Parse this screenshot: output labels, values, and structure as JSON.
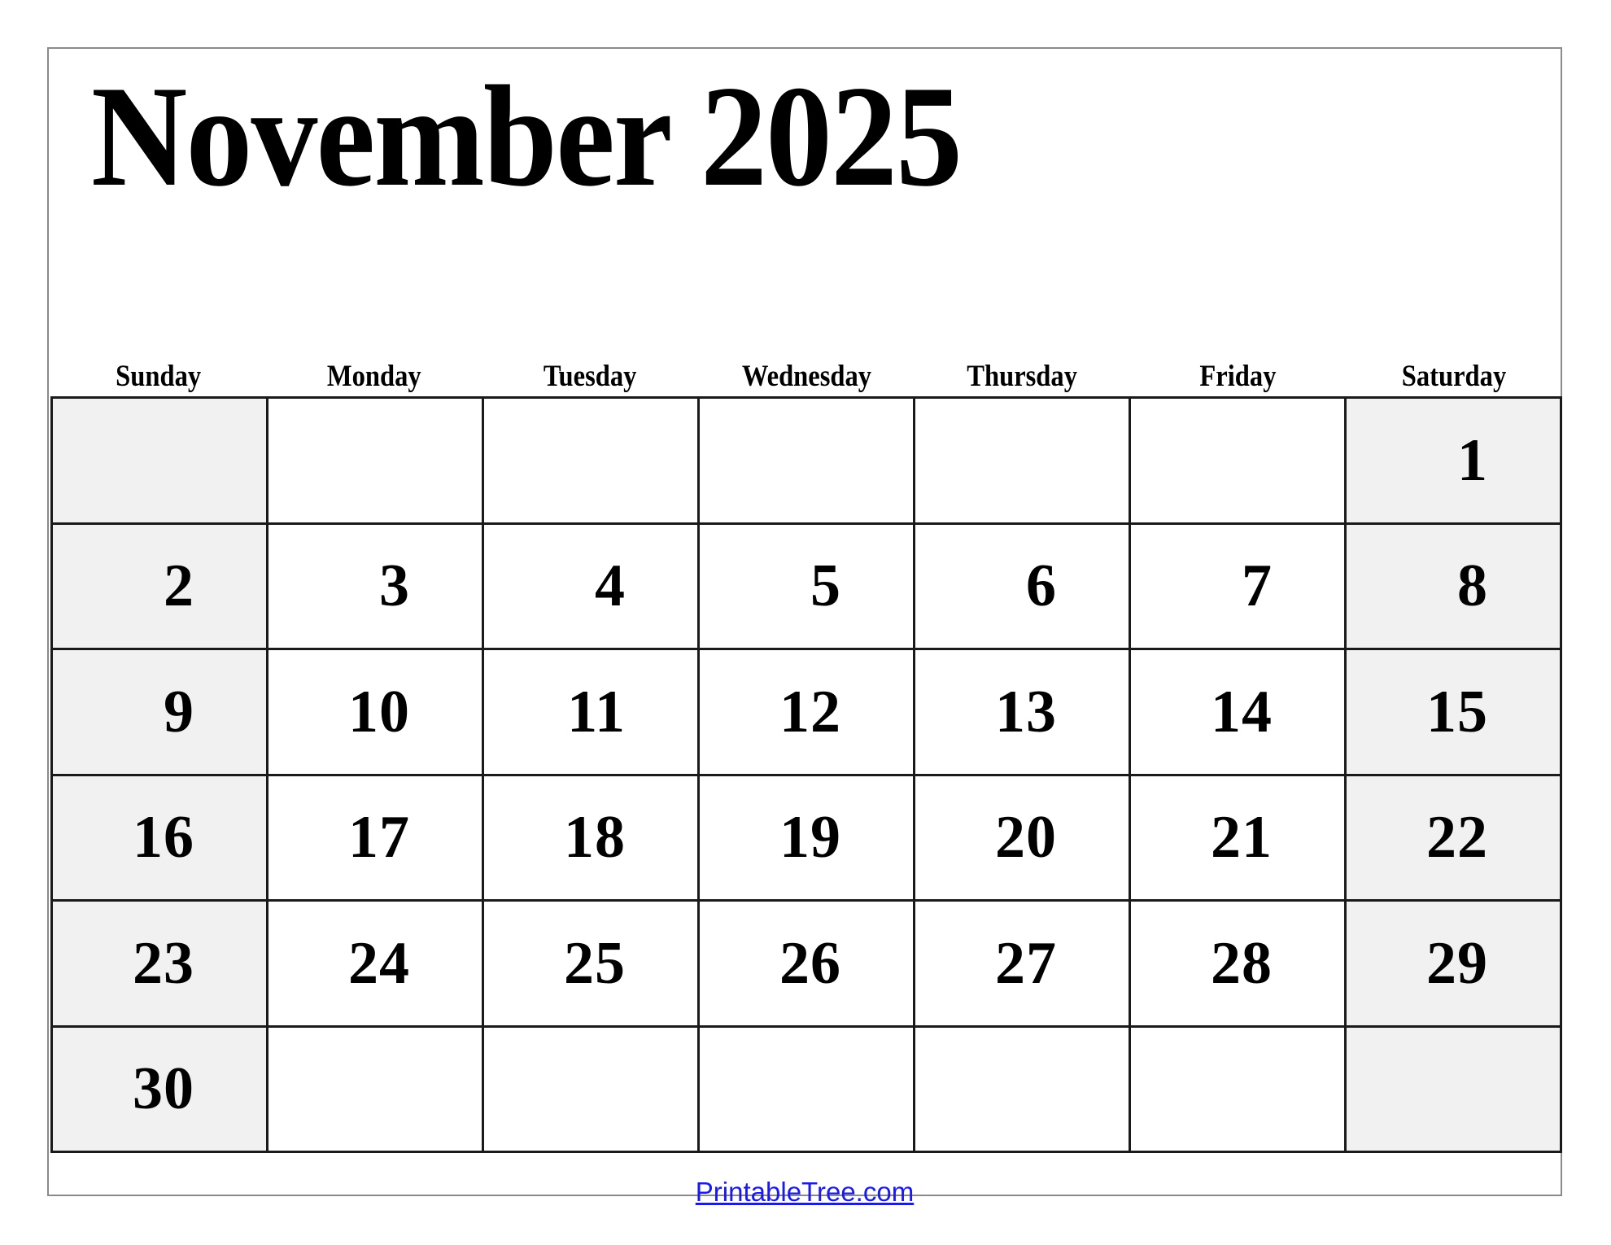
{
  "document": {
    "type": "printable-monthly-calendar",
    "month_title": "November 2025",
    "month_name": "November",
    "year": "2025"
  },
  "weekdays": [
    {
      "label": "Sunday",
      "weekend": true
    },
    {
      "label": "Monday",
      "weekend": false
    },
    {
      "label": "Tuesday",
      "weekend": false
    },
    {
      "label": "Wednesday",
      "weekend": false
    },
    {
      "label": "Thursday",
      "weekend": false
    },
    {
      "label": "Friday",
      "weekend": false
    },
    {
      "label": "Saturday",
      "weekend": true
    }
  ],
  "weeks": [
    [
      {
        "day": "",
        "weekend": true
      },
      {
        "day": "",
        "weekend": false
      },
      {
        "day": "",
        "weekend": false
      },
      {
        "day": "",
        "weekend": false
      },
      {
        "day": "",
        "weekend": false
      },
      {
        "day": "",
        "weekend": false
      },
      {
        "day": "1",
        "weekend": true
      }
    ],
    [
      {
        "day": "2",
        "weekend": true
      },
      {
        "day": "3",
        "weekend": false
      },
      {
        "day": "4",
        "weekend": false
      },
      {
        "day": "5",
        "weekend": false
      },
      {
        "day": "6",
        "weekend": false
      },
      {
        "day": "7",
        "weekend": false
      },
      {
        "day": "8",
        "weekend": true
      }
    ],
    [
      {
        "day": "9",
        "weekend": true
      },
      {
        "day": "10",
        "weekend": false
      },
      {
        "day": "11",
        "weekend": false
      },
      {
        "day": "12",
        "weekend": false
      },
      {
        "day": "13",
        "weekend": false
      },
      {
        "day": "14",
        "weekend": false
      },
      {
        "day": "15",
        "weekend": true
      }
    ],
    [
      {
        "day": "16",
        "weekend": true
      },
      {
        "day": "17",
        "weekend": false
      },
      {
        "day": "18",
        "weekend": false
      },
      {
        "day": "19",
        "weekend": false
      },
      {
        "day": "20",
        "weekend": false
      },
      {
        "day": "21",
        "weekend": false
      },
      {
        "day": "22",
        "weekend": true
      }
    ],
    [
      {
        "day": "23",
        "weekend": true
      },
      {
        "day": "24",
        "weekend": false
      },
      {
        "day": "25",
        "weekend": false
      },
      {
        "day": "26",
        "weekend": false
      },
      {
        "day": "27",
        "weekend": false
      },
      {
        "day": "28",
        "weekend": false
      },
      {
        "day": "29",
        "weekend": true
      }
    ],
    [
      {
        "day": "30",
        "weekend": true
      },
      {
        "day": "",
        "weekend": false
      },
      {
        "day": "",
        "weekend": false
      },
      {
        "day": "",
        "weekend": false
      },
      {
        "day": "",
        "weekend": false
      },
      {
        "day": "",
        "weekend": false
      },
      {
        "day": "",
        "weekend": true
      }
    ]
  ],
  "footer": {
    "link_text": "PrintableTree.com"
  },
  "colors": {
    "page_background": "#ffffff",
    "page_border": "#8a8a8a",
    "grid_line": "#1a1a1a",
    "weekend_shade": "#f1f1f1",
    "text": "#000000",
    "link": "#1a1aee"
  }
}
